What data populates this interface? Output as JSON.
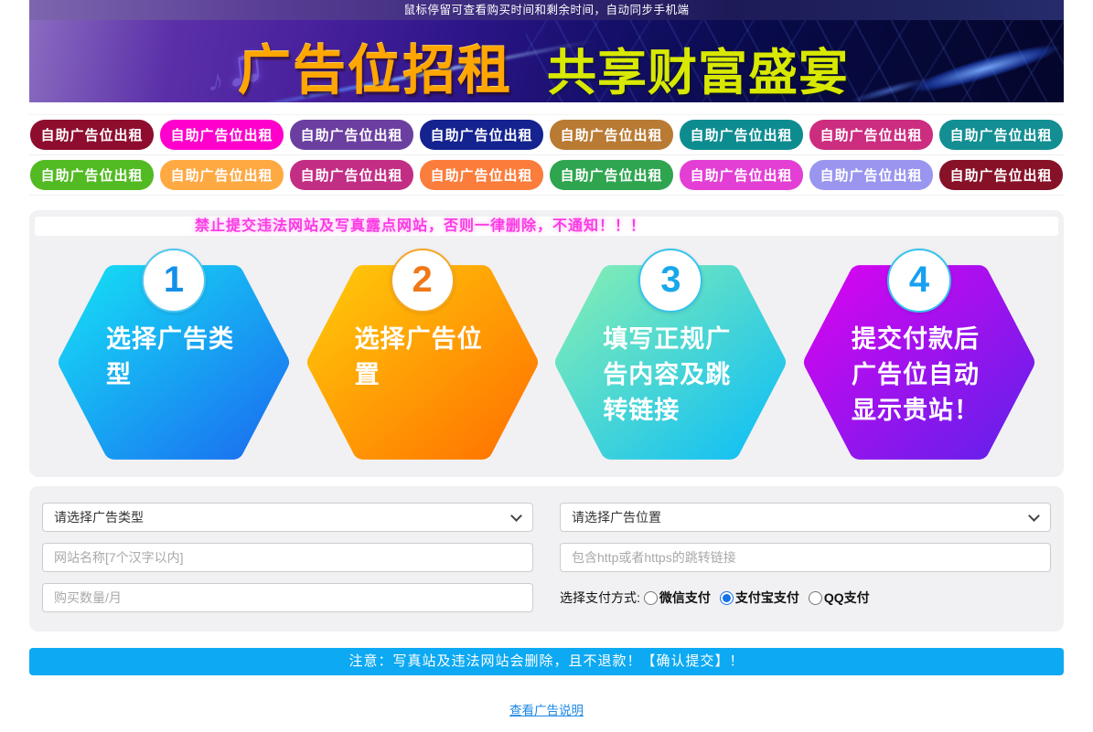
{
  "topbar": {
    "notice": "鼠标停留可查看购买时间和剩余时间，自动同步手机端"
  },
  "banner": {
    "title": "广告位招租",
    "subtitle": "共享财富盛宴",
    "title_color": "#ffa600",
    "subtitle_color": "#d9e800",
    "music_icon": "♫",
    "music_icon_small": "♪"
  },
  "ad_buttons": {
    "label": "自助广告位出租",
    "row1_colors": [
      "#8e0d2e",
      "#ff00cc",
      "#6b3fa0",
      "#14238f",
      "#b97a33",
      "#0d8c90",
      "#cc2d7f",
      "#138e92"
    ],
    "row2_colors": [
      "#52ba22",
      "#ffa943",
      "#c32e85",
      "#fb7d3c",
      "#2fa550",
      "#e33fd5",
      "#9a96ef",
      "#871228"
    ]
  },
  "steps": {
    "warning": "禁止提交违法网站及写真露点网站，否则一律删除，不通知！！！",
    "warning_color": "#fb3be4",
    "items": [
      {
        "num": "1",
        "label": "选择广告类型",
        "grad_from": "#16ddf5",
        "grad_to": "#1a6ff0",
        "num_color": "#1590e8",
        "ring_color": "#4fc6f2"
      },
      {
        "num": "2",
        "label": "选择广告位置",
        "grad_from": "#ffc80a",
        "grad_to": "#ff7300",
        "num_color": "#f07818",
        "ring_color": "#f5a623"
      },
      {
        "num": "3",
        "label": "填写正规广告内容及跳转链接",
        "grad_from": "#82edb5",
        "grad_to": "#10bff5",
        "num_color": "#18a8e8",
        "ring_color": "#35c3ee"
      },
      {
        "num": "4",
        "label": "提交付款后广告位自动显示贵站！",
        "grad_from": "#d705f0",
        "grad_to": "#6420ea",
        "num_color": "#18a0f0",
        "ring_color": "#35c3ee"
      }
    ]
  },
  "form": {
    "type_select_value": "请选择广告类型",
    "position_select_value": "请选择广告位置",
    "site_name_placeholder": "网站名称[7个汉字以内]",
    "link_placeholder": "包含http或者https的跳转链接",
    "quantity_placeholder": "购买数量/月",
    "payment": {
      "label": "选择支付方式:",
      "options": [
        {
          "key": "wechat",
          "label": "微信支付",
          "checked": false
        },
        {
          "key": "alipay",
          "label": "支付宝支付",
          "checked": true
        },
        {
          "key": "qq",
          "label": "QQ支付",
          "checked": false
        }
      ]
    }
  },
  "submit": {
    "label": "注意：写真站及违法网站会删除，且不退款！【确认提交】！",
    "color": "#0da9f2"
  },
  "footer": {
    "link_label": "查看广告说明"
  }
}
